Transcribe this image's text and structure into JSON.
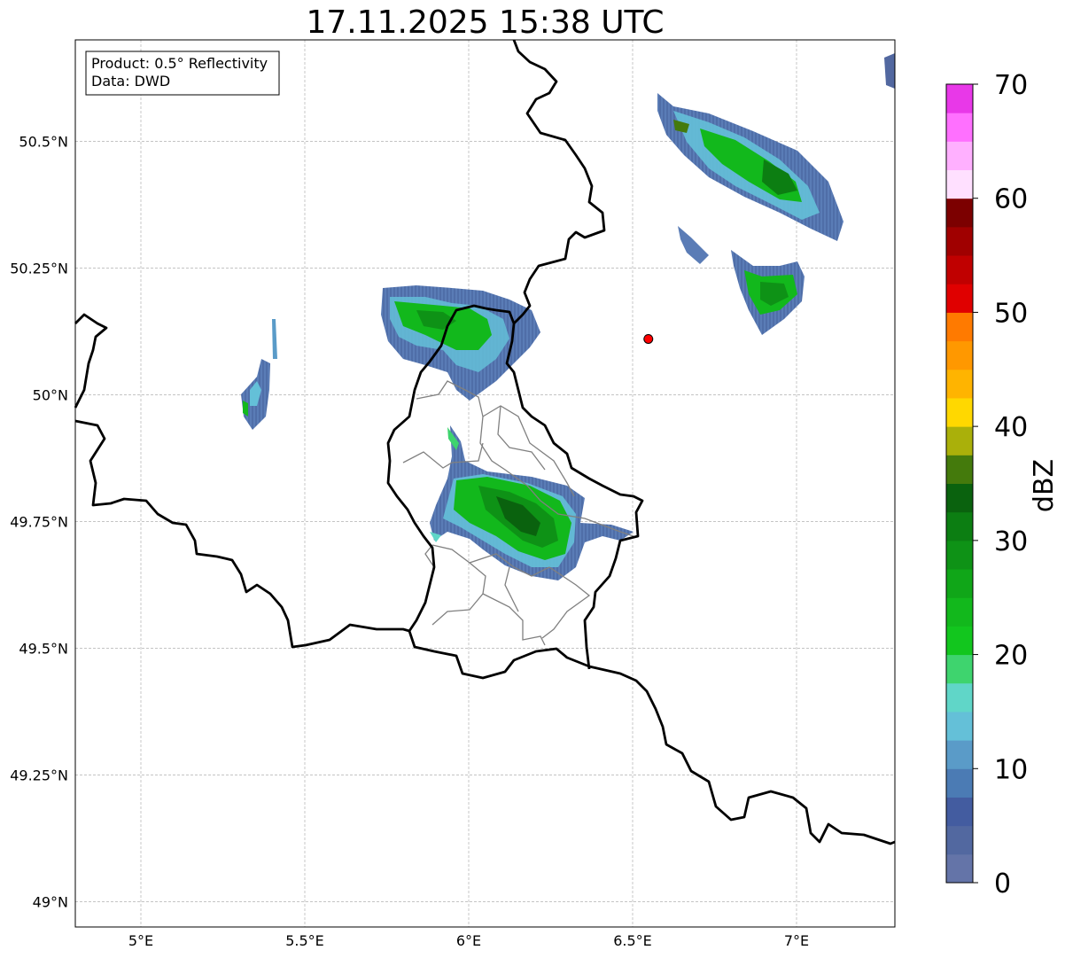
{
  "title": "17.11.2025 15:38 UTC",
  "info_box": {
    "product": "Product: 0.5° Reflectivity",
    "data": "Data: DWD"
  },
  "map": {
    "lon_range": [
      4.8,
      7.3
    ],
    "lat_range": [
      48.95,
      50.7
    ],
    "lon_ticks": [
      {
        "value": 5.0,
        "label": "5°E"
      },
      {
        "value": 5.5,
        "label": "5.5°E"
      },
      {
        "value": 6.0,
        "label": "6°E"
      },
      {
        "value": 6.5,
        "label": "6.5°E"
      },
      {
        "value": 7.0,
        "label": "7°E"
      }
    ],
    "lat_ticks": [
      {
        "value": 50.5,
        "label": "50.5°N"
      },
      {
        "value": 50.25,
        "label": "50.25°N"
      },
      {
        "value": 50.0,
        "label": "50°N"
      },
      {
        "value": 49.75,
        "label": "49.75°N"
      },
      {
        "value": 49.5,
        "label": "49.5°N"
      },
      {
        "value": 49.25,
        "label": "49.25°N"
      },
      {
        "value": 49.0,
        "label": "49°N"
      }
    ],
    "gridlines": true,
    "radar_site": {
      "lon": 6.548,
      "lat": 50.11,
      "color": "#ff0000"
    }
  },
  "colorbar": {
    "label": "dBZ",
    "min": 0,
    "max": 70,
    "tick_values": [
      0,
      10,
      20,
      30,
      40,
      50,
      60,
      70
    ],
    "colors": [
      "#6474a8",
      "#5268a0",
      "#435ca0",
      "#4b7bb4",
      "#5a9bc8",
      "#64c0d8",
      "#60d6c8",
      "#3ed46e",
      "#12c61e",
      "#12b81c",
      "#10a618",
      "#0e9216",
      "#0c7e12",
      "#0a620e",
      "#447a0c",
      "#aab00a",
      "#ffd800",
      "#ffb400",
      "#ff9800",
      "#ff7a00",
      "#e00000",
      "#c00000",
      "#a00000",
      "#7c0000",
      "#ffe0ff",
      "#ffb0ff",
      "#ff70ff",
      "#e838e8"
    ]
  }
}
